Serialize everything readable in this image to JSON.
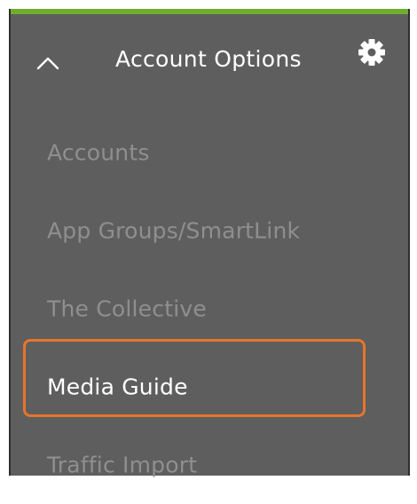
{
  "header": {
    "title": "Account Options",
    "toggle_icon": "chevron-up-icon",
    "settings_icon": "gear-icon"
  },
  "menu": {
    "items": [
      {
        "label": "Accounts"
      },
      {
        "label": "App Groups/SmartLink"
      },
      {
        "label": "The Collective"
      },
      {
        "label": "Media Guide"
      },
      {
        "label": "Traffic Import"
      }
    ],
    "selected": "Media Guide"
  },
  "colors": {
    "accent": "#6fae2c",
    "panel_bg": "#5e5e5e",
    "highlight": "#e8742a",
    "active_text": "#ffffff",
    "inactive_text": "#8f8f8f"
  }
}
